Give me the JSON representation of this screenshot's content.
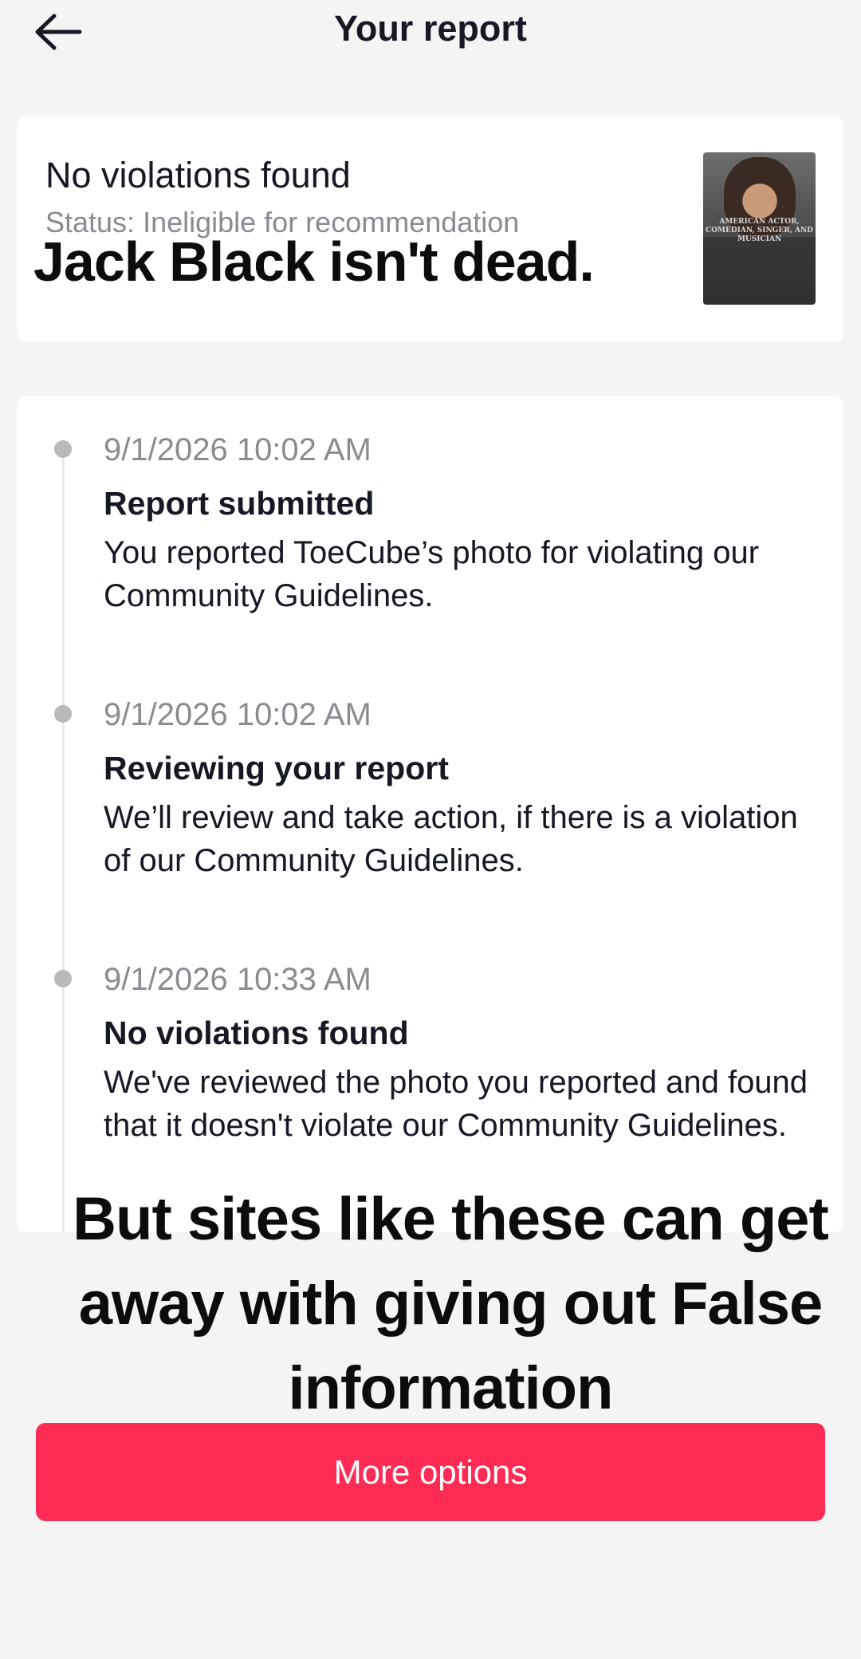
{
  "header": {
    "title": "Your report",
    "back_icon": "arrow-left-icon"
  },
  "summary": {
    "title": "No violations found",
    "status": "Status: Ineligible for recommendation",
    "thumbnail_text": "AMERICAN ACTOR, COMEDIAN, SINGER, AND MUSICIAN"
  },
  "captions": {
    "top": "Jack Black isn't dead.",
    "bottom": "But sites like these can get away with giving out False information"
  },
  "timeline": {
    "items": [
      {
        "time": "9/1/2026 10:02 AM",
        "heading": "Report submitted",
        "body": "You reported ToeCube’s photo for violating our Community Guidelines."
      },
      {
        "time": "9/1/2026 10:02 AM",
        "heading": "Reviewing your report",
        "body": "We’ll review and take action, if there is a violation of our Community Guidelines."
      },
      {
        "time": "9/1/2026 10:33 AM",
        "heading": "No violations found",
        "body": "We've reviewed the photo you reported and found that it doesn't violate our Community Guidelines."
      }
    ]
  },
  "actions": {
    "more_options": "More options"
  },
  "colors": {
    "accent": "#fe2c55",
    "background": "#f4f4f4",
    "card": "#ffffff",
    "muted_text": "#8a8b91"
  }
}
